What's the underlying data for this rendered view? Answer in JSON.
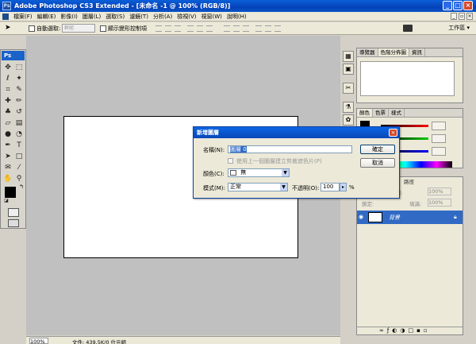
{
  "window": {
    "title": "Adobe Photoshop CS3 Extended - [未命名 -1 @ 100% (RGB/8)]",
    "ps_icon": "Ps"
  },
  "menu": {
    "items": [
      "檔案(F)",
      "編輯(E)",
      "影像(I)",
      "圖層(L)",
      "選取(S)",
      "濾鏡(T)",
      "分析(A)",
      "檢視(V)",
      "視窗(W)",
      "說明(H)"
    ]
  },
  "options": {
    "auto_select_label": "自動選取:",
    "auto_select_value": "群組",
    "show_transform_label": "顯示變形控制項",
    "workspace_label": "工作區 ▾"
  },
  "tools": {
    "logo": "Ps"
  },
  "panels": {
    "nav_tabs": [
      "導覽器",
      "色階分佈圖",
      "資訊"
    ],
    "color_tabs": [
      "顏色",
      "色票",
      "樣式"
    ],
    "layers": {
      "opacity_label": "不透明:",
      "opacity_value": "100%",
      "lock_label": "鎖定:",
      "fill_label": "填滿:",
      "fill_value": "100%",
      "layer_name": "背景",
      "tab_partial": "路徑"
    }
  },
  "status": {
    "zoom": "100%",
    "doc_info": "文件: 439.5K/0 位元組"
  },
  "dialog": {
    "title": "新增圖層",
    "name_label": "名稱(N):",
    "name_value": "圖層 0",
    "use_previous_label": "使用上一個圖層建立剪裁遮色片(P)",
    "color_label": "顏色(C):",
    "color_value": "無",
    "mode_label": "模式(M):",
    "mode_value": "正常",
    "opacity_label": "不透明(O):",
    "opacity_value": "100",
    "percent": "%",
    "ok_label": "確定",
    "cancel_label": "取消"
  }
}
